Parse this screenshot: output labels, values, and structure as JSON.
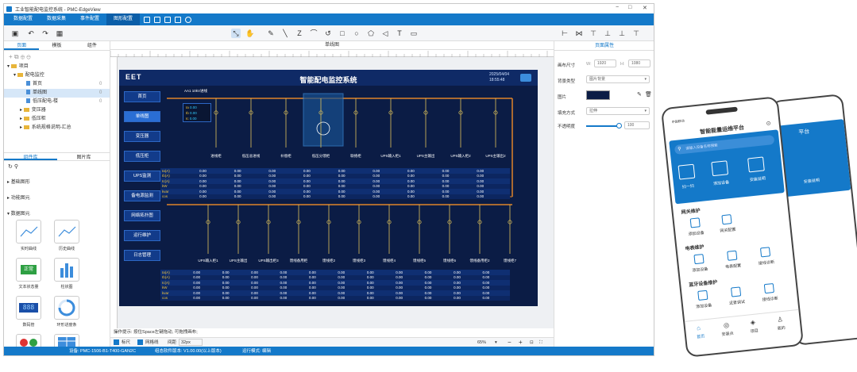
{
  "window": {
    "title": "工业智能配电监控系统 - PMC-EdgeView",
    "minimize": "−",
    "maximize": "□",
    "close": "✕"
  },
  "menu": [
    {
      "label": "数据配置"
    },
    {
      "label": "数据采集"
    },
    {
      "label": "事件配置"
    },
    {
      "label": "图形配置"
    }
  ],
  "left_panel": {
    "tabs": [
      "页面",
      "模板",
      "组件"
    ],
    "tree": [
      {
        "label": "项目",
        "level": 0,
        "type": "folder"
      },
      {
        "label": "配电监控",
        "level": 1,
        "type": "folder"
      },
      {
        "label": "首页",
        "level": 2,
        "type": "page",
        "badge": "0"
      },
      {
        "label": "单线图",
        "level": 2,
        "type": "page",
        "badge": "0",
        "selected": true
      },
      {
        "label": "低压配电-楼",
        "level": 2,
        "type": "page",
        "badge": "0"
      },
      {
        "label": "变压器",
        "level": 1,
        "type": "folder"
      },
      {
        "label": "低压柜",
        "level": 1,
        "type": "folder"
      },
      {
        "label": "系统规格说明-汇总",
        "level": 1,
        "type": "folder"
      }
    ],
    "lib_tabs": [
      "组件库",
      "图片库"
    ],
    "sections": [
      "基础图形",
      "功能图元",
      "数据图元"
    ],
    "components": [
      {
        "label": "实时曲线"
      },
      {
        "label": "历史曲线"
      },
      {
        "label": "文本状态量"
      },
      {
        "label": "柱状图"
      },
      {
        "label": "数码管"
      },
      {
        "label": "环形进度条"
      }
    ],
    "badge_text": "正常",
    "lcd_text": "888"
  },
  "canvas_tab": "单线图",
  "scada": {
    "logo": "EET",
    "title": "智能配电监控系统",
    "date": "2025/04/04",
    "time": "18:55:48",
    "nav": [
      "首页",
      "单线图",
      "变压器",
      "低压柜",
      "UPS监测",
      "备电源监测",
      "网络拓扑图",
      "运行维护",
      "日志管理"
    ],
    "bus_label": "AA1 10kV进线",
    "meter": [
      {
        "k": "Ia",
        "v": "0.00"
      },
      {
        "k": "Ib",
        "v": "0.00"
      },
      {
        "k": "Ic",
        "v": "0.00"
      }
    ],
    "top_feeders": [
      "进线柜",
      "低压总进线",
      "补偿柜",
      "低压分馈柜",
      "联络柜",
      "UPS输入柜1",
      "UPS主输出",
      "UPS输入柜2",
      "UPS主输出2"
    ],
    "row_keys": [
      "Ia(A)",
      "Ib(A)",
      "Ic(A)",
      "kW",
      "kvar",
      "cos"
    ],
    "cell_value": "0.00",
    "bottom_feeders": [
      "UPS输入柜1",
      "UPS主输出",
      "UPS输出柜3",
      "馈线备用柜",
      "馈线柜2",
      "馈线柜3",
      "馈线柜4",
      "馈线柜5",
      "馈线柜6",
      "馈线备用柜2",
      "馈线柜7"
    ]
  },
  "right_panel": {
    "title": "页面属性",
    "size_label": "画布尺寸",
    "w_label": "W:",
    "w": "1920",
    "h_label": "H:",
    "h": "1080",
    "bg_type_label": "背景类型",
    "bg_type": "图片背景",
    "image_label": "图片",
    "fill_label": "填充方式",
    "fill": "拉伸",
    "opacity_label": "不透明度",
    "opacity": "100"
  },
  "bottom_bar": {
    "hint": "操作提示: 按住Space左键拖动, 可拖拽画布;",
    "ruler": "标尺",
    "grid": "网格线",
    "snap_label": "间距",
    "snap": "32px",
    "zoom": "65%"
  },
  "status_bar": {
    "device": "设备: PMC-1506-B1-T400-GAN2C",
    "version": "组态软件版本: V1.00.00(以上版本)",
    "mode": "运行模式: 编辑"
  },
  "phone_front": {
    "title": "智能能量运维平台",
    "search": "请输入设备名称搜索",
    "quick": [
      "扫一扫",
      "添加设备",
      "安装说明"
    ],
    "sections": [
      {
        "title": "网关维护",
        "items": [
          "添加设备",
          "网关配置"
        ]
      },
      {
        "title": "电表维护",
        "items": [
          "添加设备",
          "电表配置",
          "接线诊断"
        ]
      },
      {
        "title": "蓝牙设备维护",
        "items": [
          "添加设备",
          "近景调试",
          "接线诊断"
        ]
      }
    ],
    "tabs": [
      "首页",
      "安装点",
      "项目",
      "我的"
    ],
    "status_left": "中国移动"
  },
  "phone_back": {
    "title": "平台",
    "quick": "安装说明"
  },
  "colors": {
    "accent": "#1479c9",
    "scada_bg": "#0b1c45",
    "bus": "#e0832a"
  }
}
